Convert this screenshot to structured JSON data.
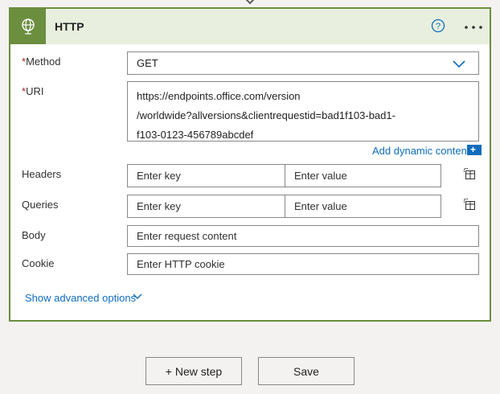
{
  "card": {
    "title": "HTTP",
    "icon": "globe-icon",
    "accent_color": "#6b8e3f",
    "header_bg": "#e8efdf"
  },
  "method": {
    "label": "Method",
    "required_mark": "*",
    "value": "GET"
  },
  "uri": {
    "label": "URI",
    "required_mark": "*",
    "lines": [
      "https://endpoints.office.com/version",
      "/worldwide?allversions&clientrequestid=bad1f103-bad1-",
      "f103-0123-456789abcdef"
    ]
  },
  "add_dynamic_content": "Add dynamic content",
  "add_dynamic_plus": "+",
  "headers": {
    "label": "Headers",
    "key_placeholder": "Enter key",
    "value_placeholder": "Enter value"
  },
  "queries": {
    "label": "Queries",
    "key_placeholder": "Enter key",
    "value_placeholder": "Enter value"
  },
  "body": {
    "label": "Body",
    "placeholder": "Enter request content"
  },
  "cookie": {
    "label": "Cookie",
    "placeholder": "Enter HTTP cookie"
  },
  "show_advanced": "Show advanced options",
  "buttons": {
    "new_step": "+ New step",
    "save": "Save"
  },
  "colors": {
    "link": "#0f6cbd",
    "required": "#a4262c"
  }
}
